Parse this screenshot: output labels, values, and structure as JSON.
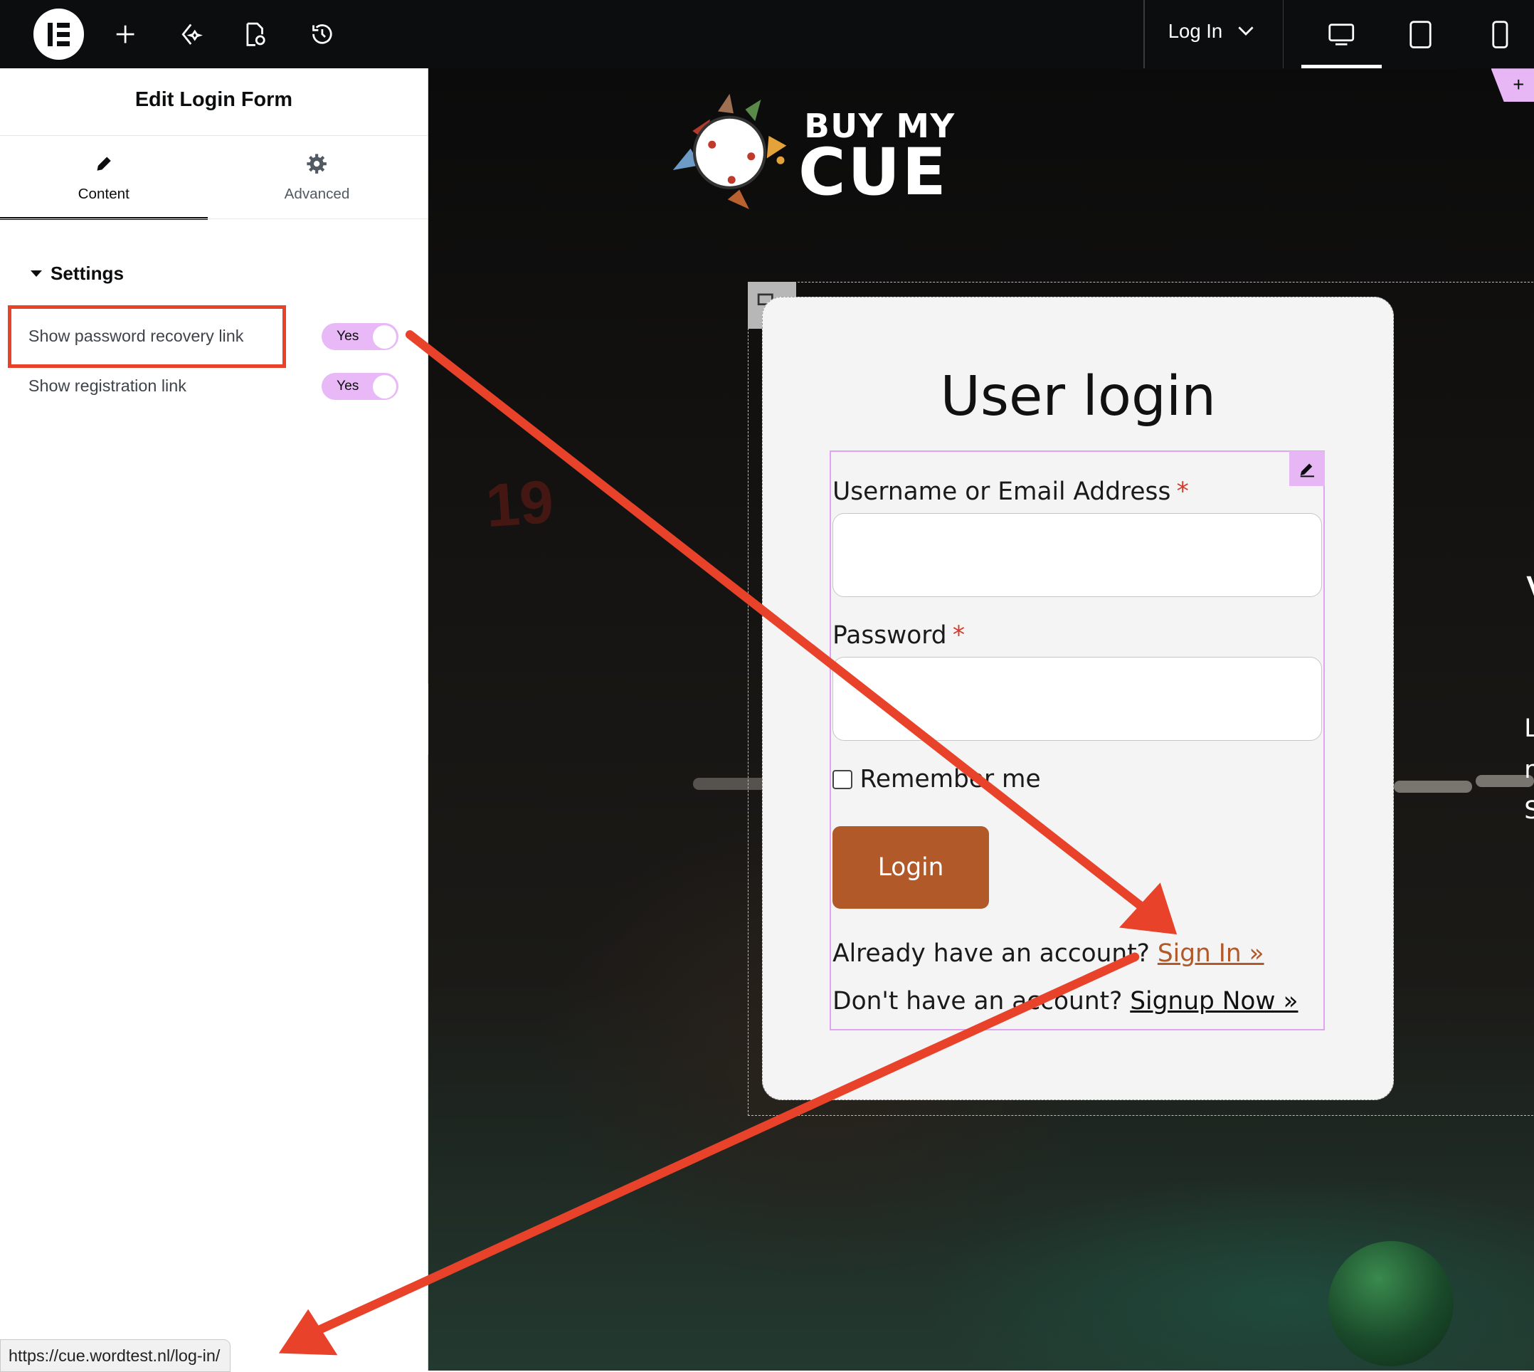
{
  "toolbar": {
    "page_name": "Log In",
    "icons": [
      "elementor-logo-icon",
      "add-icon",
      "ai-sparkle-icon",
      "page-settings-icon",
      "history-icon",
      "desktop-icon",
      "tablet-icon",
      "mobile-icon"
    ]
  },
  "panel": {
    "title": "Edit Login Form",
    "tabs": [
      {
        "label": "Content",
        "icon": "pencil-icon",
        "active": true
      },
      {
        "label": "Advanced",
        "icon": "gear-icon",
        "active": false
      }
    ],
    "section_title": "Settings",
    "controls": [
      {
        "label": "Show password recovery link",
        "value": "Yes",
        "highlighted": true
      },
      {
        "label": "Show registration link",
        "value": "Yes",
        "highlighted": false
      }
    ]
  },
  "status_url": "https://cue.wordtest.nl/log-in/",
  "preview": {
    "brand_line1": "BUY MY",
    "brand_line2": "CUE",
    "background_number": "19",
    "form": {
      "title": "User login",
      "username_label": "Username or Email Address",
      "password_label": "Password",
      "required_mark": "*",
      "remember_label": "Remember me",
      "login_button": "Login",
      "signin_prefix": "Already have an account?",
      "signin_link": "Sign In »",
      "signup_prefix": "Don't have an account?",
      "signup_link": "Signup Now »"
    },
    "side_letters": [
      "V",
      "L",
      "r",
      "S"
    ]
  },
  "colors": {
    "accent_pink": "#e7b7f5",
    "button_brown": "#b2592a",
    "annotation_red": "#e8432a",
    "topbar": "#0c0d0e"
  }
}
